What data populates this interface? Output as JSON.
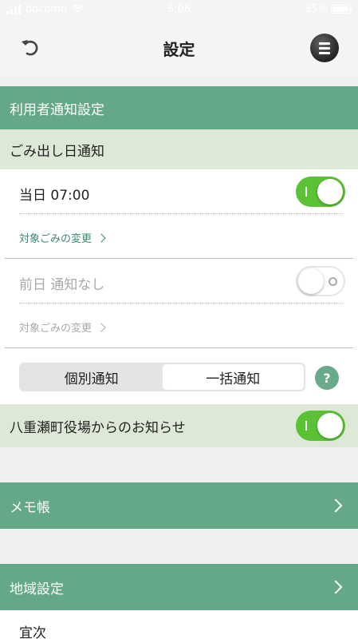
{
  "status_bar": {
    "carrier": "docomo",
    "time": "6:06",
    "battery": "95%",
    "battery_level": 0.95
  },
  "nav": {
    "title": "設定",
    "back_icon": "undo-arrow-icon",
    "menu_icon": "hamburger-menu-icon"
  },
  "user_notification": {
    "header": "利用者通知設定",
    "garbage_day": {
      "header": "ごみ出し日通知",
      "same_day": {
        "label": "当日 07:00",
        "enabled": true,
        "link": "対象ごみの変更"
      },
      "prev_day": {
        "label": "前日 通知なし",
        "enabled": false,
        "link": "対象ごみの変更"
      }
    },
    "segmented": {
      "options": [
        "個別通知",
        "一括通知"
      ],
      "selected": "一括通知"
    },
    "help_label": "?",
    "town_notice": {
      "label": "八重瀬町役場からのお知らせ",
      "enabled": true
    }
  },
  "memo": {
    "header": "メモ帳"
  },
  "region": {
    "header": "地域設定",
    "value": "宜次"
  },
  "colors": {
    "header_green": "#64a887",
    "subheader_green": "#dde9d6",
    "toggle_green": "#5bc236",
    "link_green": "#3d8a6b"
  }
}
